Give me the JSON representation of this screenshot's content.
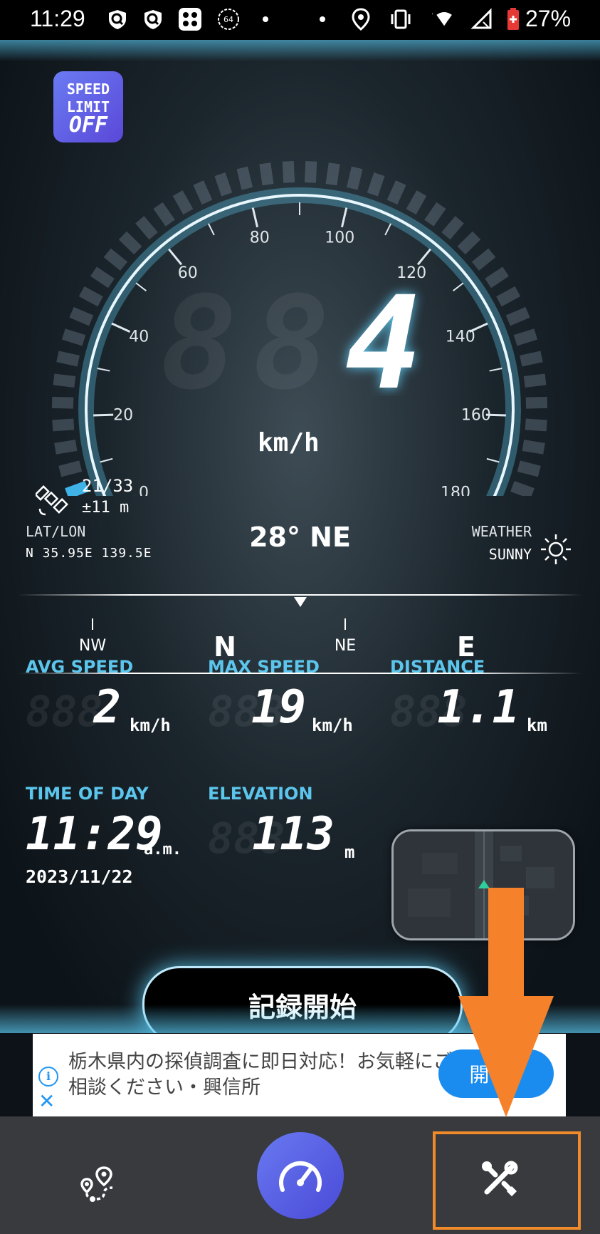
{
  "status_bar": {
    "time": "11:29",
    "battery": "27%",
    "icons": [
      "shield-search-icon",
      "shield-search-icon",
      "app-grid-icon",
      "speed-64-icon",
      "dot",
      "dot",
      "location-icon",
      "vibrate-icon",
      "wifi-icon",
      "signal-icon",
      "battery-icon"
    ]
  },
  "speed_limit": {
    "line1": "SPEED",
    "line2": "LIMIT",
    "state": "OFF"
  },
  "gauge": {
    "ticks": [
      "0",
      "20",
      "40",
      "60",
      "80",
      "100",
      "120",
      "140",
      "160",
      "180"
    ],
    "current_speed": "4",
    "speed_ghost": "8",
    "unit": "km/h",
    "needle_fraction": 0.022
  },
  "gps": {
    "satellites": "21/33",
    "accuracy": "±11 m"
  },
  "location": {
    "label": "LAT/LON",
    "value": "N 35.95E 139.5E"
  },
  "heading": "28° NE",
  "weather": {
    "label": "WEATHER",
    "value": "SUNNY"
  },
  "compass": {
    "labels": [
      "NW",
      "N",
      "NE",
      "E"
    ]
  },
  "stats": {
    "avg": {
      "label": "AVG SPEED",
      "value": "2",
      "unit": "km/h"
    },
    "max": {
      "label": "MAX SPEED",
      "value": "19",
      "unit": "km/h"
    },
    "distance": {
      "label": "DISTANCE",
      "value": "1.1",
      "unit": "km"
    },
    "time": {
      "label": "TIME OF DAY",
      "value": "11:29",
      "unit": "a.m.",
      "date": "2023/11/22"
    },
    "elevation": {
      "label": "ELEVATION",
      "value": "113",
      "unit": "m"
    }
  },
  "ghost_digits": "888",
  "record_button": "記録開始",
  "ad": {
    "text": "栃木県内の探偵調査に即日対応！お気軽にご相談ください・興信所",
    "button": "開く",
    "info": "i",
    "close": "✕"
  },
  "nav": {
    "items": [
      "route-icon",
      "speedometer-icon",
      "tools-icon"
    ]
  },
  "colors": {
    "accent": "#5cc5ec",
    "highlight": "#f08a2a",
    "nav_bg": "#383a3e"
  }
}
